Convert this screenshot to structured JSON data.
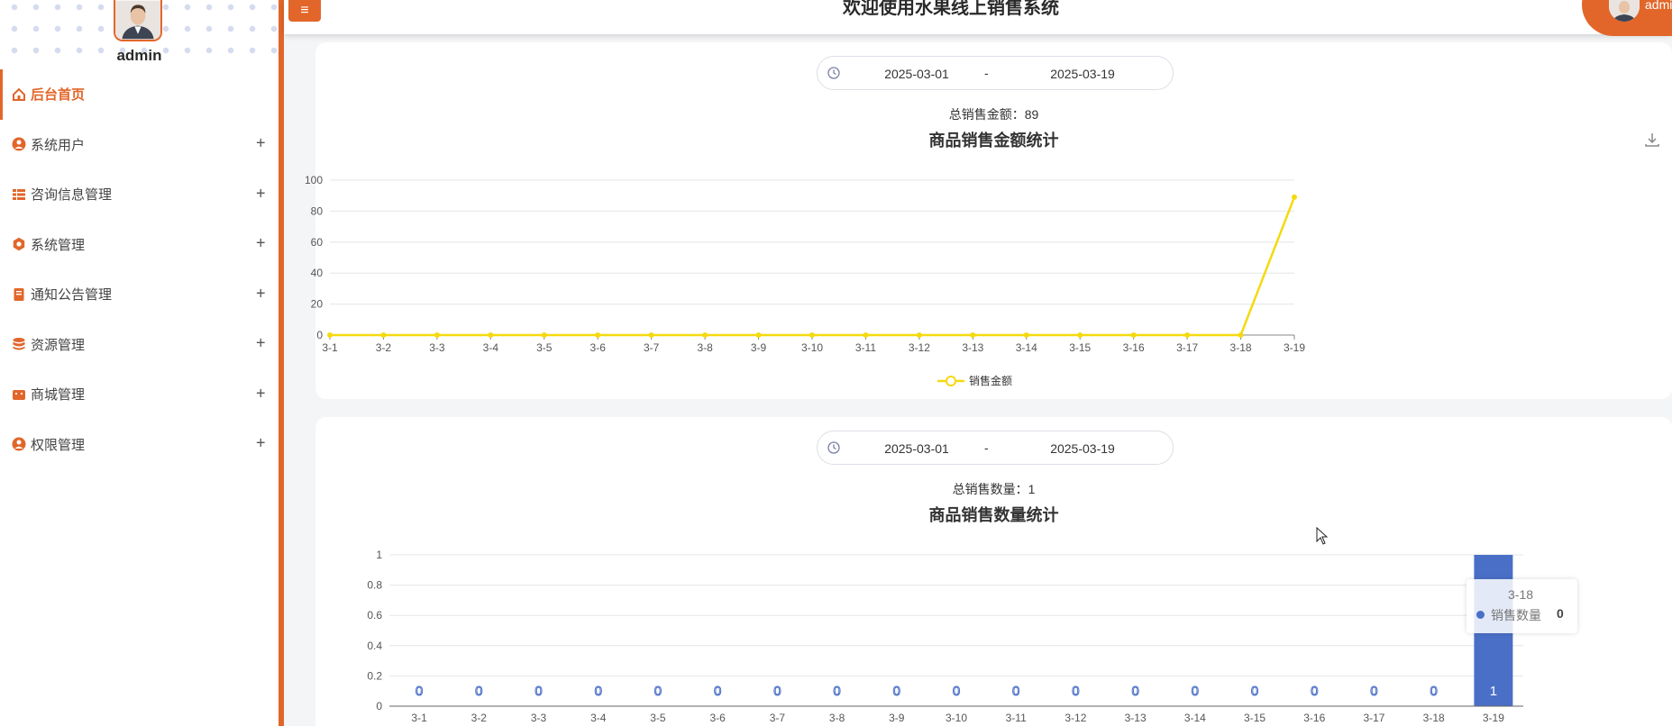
{
  "header": {
    "title": "欢迎使用水果线上销售系统",
    "menu_icon": "≡",
    "user_name": "admin"
  },
  "sidebar": {
    "admin_name": "admin",
    "items": [
      {
        "label": "后台首页",
        "icon": "home-icon",
        "active": true,
        "plus": ""
      },
      {
        "label": "系统用户",
        "icon": "user-circle-icon",
        "active": false,
        "plus": "+"
      },
      {
        "label": "咨询信息管理",
        "icon": "grid-icon",
        "active": false,
        "plus": "+"
      },
      {
        "label": "系统管理",
        "icon": "settings-icon",
        "active": false,
        "plus": "+"
      },
      {
        "label": "通知公告管理",
        "icon": "notice-icon",
        "active": false,
        "plus": "+"
      },
      {
        "label": "资源管理",
        "icon": "database-icon",
        "active": false,
        "plus": "+"
      },
      {
        "label": "商城管理",
        "icon": "shop-icon",
        "active": false,
        "plus": "+"
      },
      {
        "label": "权限管理",
        "icon": "permission-icon",
        "active": false,
        "plus": "+"
      }
    ]
  },
  "colors": {
    "accent": "#e2662a",
    "line": "#f5d90f",
    "bar": "#4a6fc7"
  },
  "panels": [
    {
      "date_start": "2025-03-01",
      "date_sep": "-",
      "date_end": "2025-03-19",
      "total_label": "总销售金额：",
      "total_value": "89",
      "chart_title": "商品销售金额统计"
    },
    {
      "date_start": "2025-03-01",
      "date_sep": "-",
      "date_end": "2025-03-19",
      "total_label": "总销售数量：",
      "total_value": "1",
      "chart_title": "商品销售数量统计"
    }
  ],
  "tooltip": {
    "title": "3-18",
    "label": "销售数量",
    "value": "0"
  },
  "chart_data": [
    {
      "type": "line",
      "title": "商品销售金额统计",
      "categories": [
        "3-1",
        "3-2",
        "3-3",
        "3-4",
        "3-5",
        "3-6",
        "3-7",
        "3-8",
        "3-9",
        "3-10",
        "3-11",
        "3-12",
        "3-13",
        "3-14",
        "3-15",
        "3-16",
        "3-17",
        "3-18",
        "3-19"
      ],
      "series": [
        {
          "name": "销售金额",
          "values": [
            0,
            0,
            0,
            0,
            0,
            0,
            0,
            0,
            0,
            0,
            0,
            0,
            0,
            0,
            0,
            0,
            0,
            0,
            89
          ]
        }
      ],
      "ylim": [
        0,
        100
      ],
      "yticks": [
        "0",
        "20",
        "40",
        "60",
        "80",
        "100"
      ],
      "grid": true,
      "legend": "bottom-center"
    },
    {
      "type": "bar",
      "title": "商品销售数量统计",
      "categories": [
        "3-1",
        "3-2",
        "3-3",
        "3-4",
        "3-5",
        "3-6",
        "3-7",
        "3-8",
        "3-9",
        "3-10",
        "3-11",
        "3-12",
        "3-13",
        "3-14",
        "3-15",
        "3-16",
        "3-17",
        "3-18",
        "3-19"
      ],
      "series": [
        {
          "name": "销售数量",
          "values": [
            0,
            0,
            0,
            0,
            0,
            0,
            0,
            0,
            0,
            0,
            0,
            0,
            0,
            0,
            0,
            0,
            0,
            0,
            1
          ]
        }
      ],
      "ylim": [
        0,
        1
      ],
      "yticks": [
        "0",
        "0.2",
        "0.4",
        "0.6",
        "0.8",
        "1"
      ],
      "grid": true,
      "data_labels": true
    }
  ]
}
